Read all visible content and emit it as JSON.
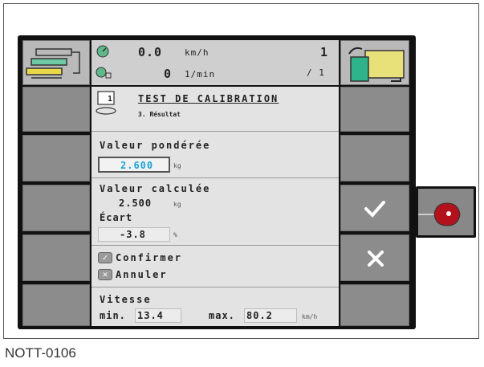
{
  "header": {
    "speed_value": "0.0",
    "speed_unit": "km/h",
    "rpm_value": "0",
    "rpm_unit": "1/min",
    "page_number": "1",
    "page_total": "/ 1"
  },
  "screen": {
    "title": "TEST DE CALIBRATION",
    "subtitle": "3. Résultat"
  },
  "weighed": {
    "label": "Valeur pondérée",
    "value": "2.600",
    "unit": "kg"
  },
  "calculated": {
    "label": "Valeur calculée",
    "value": "2.500",
    "unit": "kg"
  },
  "deviation": {
    "label": "Écart",
    "value": "-3.8",
    "unit": "%"
  },
  "options": {
    "confirm_label": "Confirmer",
    "cancel_label": "Annuler"
  },
  "speed": {
    "label": "Vitesse",
    "min_label": "min.",
    "min_value": "13.4",
    "max_label": "max.",
    "max_value": "80.2",
    "unit": "km/h"
  },
  "softkeys": {
    "confirm_icon": "check-icon",
    "cancel_icon": "cross-icon"
  },
  "caption": "NOTT-0106",
  "colors": {
    "highlight_value": "#1ba3d6",
    "terminal": "#111111",
    "softkey": "#8c8c8c"
  }
}
